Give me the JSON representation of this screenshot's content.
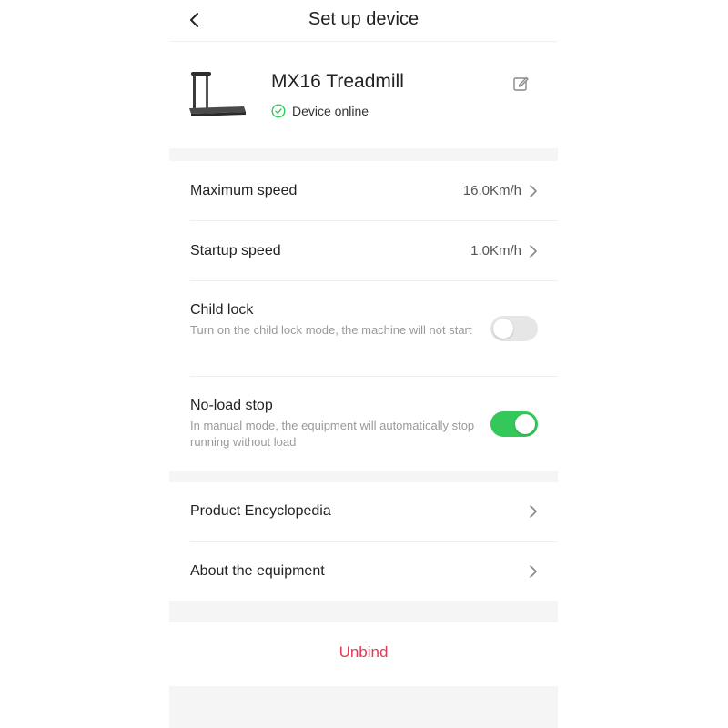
{
  "header": {
    "title": "Set up device"
  },
  "device": {
    "name": "MX16 Treadmill",
    "status": "Device online"
  },
  "settings": {
    "max_speed": {
      "label": "Maximum speed",
      "value": "16.0Km/h"
    },
    "startup_speed": {
      "label": "Startup speed",
      "value": "1.0Km/h"
    },
    "child_lock": {
      "label": "Child lock",
      "desc": "Turn on the child lock mode, the machine will not start",
      "enabled": false
    },
    "no_load_stop": {
      "label": "No-load stop",
      "desc": "In manual mode, the equipment will automatically stop running without load",
      "enabled": true
    }
  },
  "info": {
    "encyclopedia": "Product Encyclopedia",
    "about": "About the equipment"
  },
  "unbind": "Unbind",
  "colors": {
    "accent_green": "#34c759",
    "danger": "#e23a55",
    "toggle_off": "#e6e6e6"
  }
}
